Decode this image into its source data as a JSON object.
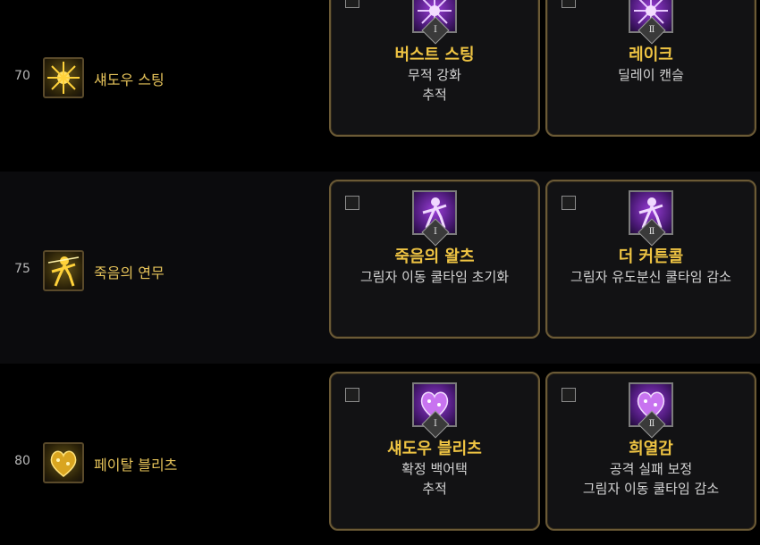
{
  "rows": [
    {
      "level": "70",
      "skill_name": "섀도우 스팅",
      "skill_icon": "star-burst-icon",
      "options": [
        {
          "roman": "Ⅰ",
          "title": "버스트 스팅",
          "desc": [
            "무적 강화",
            "추적"
          ],
          "rune_icon": "burst-rune-icon"
        },
        {
          "roman": "Ⅱ",
          "title": "레이크",
          "desc": [
            "딜레이 캔슬"
          ],
          "rune_icon": "burst-rune-icon"
        }
      ]
    },
    {
      "level": "75",
      "skill_name": "죽음의 연무",
      "skill_icon": "dancer-figure-icon",
      "options": [
        {
          "roman": "Ⅰ",
          "title": "죽음의 왈츠",
          "desc": [
            "그림자 이동 쿨타임 초기화"
          ],
          "rune_icon": "dancer-rune-icon"
        },
        {
          "roman": "Ⅱ",
          "title": "더 커튼콜",
          "desc": [
            "그림자 유도분신 쿨타임 감소"
          ],
          "rune_icon": "dancer-rune-icon"
        }
      ]
    },
    {
      "level": "80",
      "skill_name": "페이탈 블리츠",
      "skill_icon": "heart-icon",
      "options": [
        {
          "roman": "Ⅰ",
          "title": "섀도우 블리츠",
          "desc": [
            "확정 백어택",
            "추적"
          ],
          "rune_icon": "heart-rune-icon"
        },
        {
          "roman": "Ⅱ",
          "title": "희열감",
          "desc": [
            "공격 실패 보정",
            "그림자 이동 쿨타임 감소"
          ],
          "rune_icon": "heart-rune-icon"
        }
      ]
    }
  ],
  "colors": {
    "title_gold": "#efc443",
    "skill_name_gold": "#e6c35a",
    "card_border": "#6b5a36",
    "rune_purple": "#9a3ed8"
  }
}
